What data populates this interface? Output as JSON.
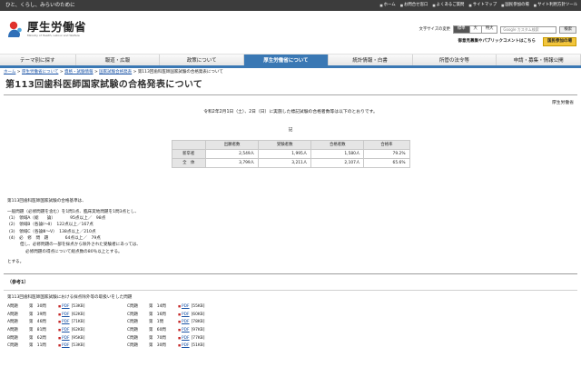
{
  "topbar": {
    "tagline": "ひと、くらし、みらいのために",
    "links": [
      "ホーム",
      "お問合せ窓口",
      "よくあるご質問",
      "サイトマップ",
      "国民参加の場",
      "サイト利用方針ツール"
    ]
  },
  "logo": {
    "jp": "厚生労働省",
    "en": "Ministry of Health, Labour and Welfare"
  },
  "tools": {
    "fontsize_label": "文字サイズの変更",
    "fontsizes": [
      "標準",
      "大",
      "特大"
    ],
    "search_placeholder": "Google カスタム検索",
    "search_button": "検索"
  },
  "pubrow": {
    "text": "御意見募集やパブリックコメントはこちら",
    "notice": "国民参加の場"
  },
  "nav": [
    "テーマ別に探す",
    "報道・広報",
    "政策について",
    "厚生労働省について",
    "統計情報・白書",
    "所管の法令等",
    "申請・募集・情報公開"
  ],
  "breadcrumb": {
    "links": [
      "ホーム",
      "厚生労働省について",
      "資格・試験情報",
      "国家試験合格発表"
    ],
    "current": "第113回歯科医師国家試験の合格発表について"
  },
  "page": {
    "title": "第113回歯科医師国家試験の合格発表について",
    "org": "厚生労働省",
    "intro": "令和2年2月1日（土）、2日（日）に実施した標記試験の合格者数等は以下のとおりです。",
    "ki": "記"
  },
  "results": {
    "headers": [
      "",
      "出願者数",
      "受験者数",
      "合格者数",
      "合格率"
    ],
    "rows": [
      {
        "label": "新卒者",
        "applicants": "2,549人",
        "examinees": "1,995人",
        "passed": "1,580人",
        "rate": "79.2%"
      },
      {
        "label": "全　体",
        "applicants": "3,799人",
        "examinees": "3,211人",
        "passed": "2,107人",
        "rate": "65.6%"
      }
    ]
  },
  "criteria": {
    "lead": "第113回歯科医師国家試験の合格基準は、",
    "line2": "一般問題（必修問題を含む）を1問1点、臨床実地問題を1問3点とし、",
    "items": [
      "(1)　領域A（総　　論）　　　　95点以上／　98点",
      "(2)　領域B（各論Ⅰ～Ⅱ）　122点以上／167点",
      "(3)　領域C（各論Ⅲ～Ⅴ）　138点以上／210点",
      "(4)　必　修　問　題　　　　64点以上／　79点"
    ],
    "note1": "但し、必修問題の一部を採点から除外された受験者にあっては、",
    "note2": "必修問題の得点について総点数の80％以上とする。",
    "end": "とする。"
  },
  "reference": {
    "title": "（参考1）",
    "intro": "第113回歯科医師国家試験における採点除外等の取扱いをした問題",
    "pdf_label": "PDF",
    "left": [
      {
        "block": "A問題",
        "num": "第　30問",
        "size": "[53KB]"
      },
      {
        "block": "A問題",
        "num": "第　39問",
        "size": "[62KB]"
      },
      {
        "block": "A問題",
        "num": "第　46問",
        "size": "[71KB]"
      },
      {
        "block": "A問題",
        "num": "第　81問",
        "size": "[62KB]"
      },
      {
        "block": "B問題",
        "num": "第　62問",
        "size": "[95KB]"
      },
      {
        "block": "C問題",
        "num": "第　11問",
        "size": "[53KB]"
      }
    ],
    "right": [
      {
        "block": "C問題",
        "num": "第　14問",
        "size": "[55KB]"
      },
      {
        "block": "C問題",
        "num": "第　16問",
        "size": "[60KB]"
      },
      {
        "block": "C問題",
        "num": "第　1問",
        "size": "[78KB]"
      },
      {
        "block": "C問題",
        "num": "第　60問",
        "size": "[97KB]"
      },
      {
        "block": "C問題",
        "num": "第　70問",
        "size": "[77KB]"
      },
      {
        "block": "C問題",
        "num": "第　30問",
        "size": "[51KB]"
      }
    ]
  }
}
